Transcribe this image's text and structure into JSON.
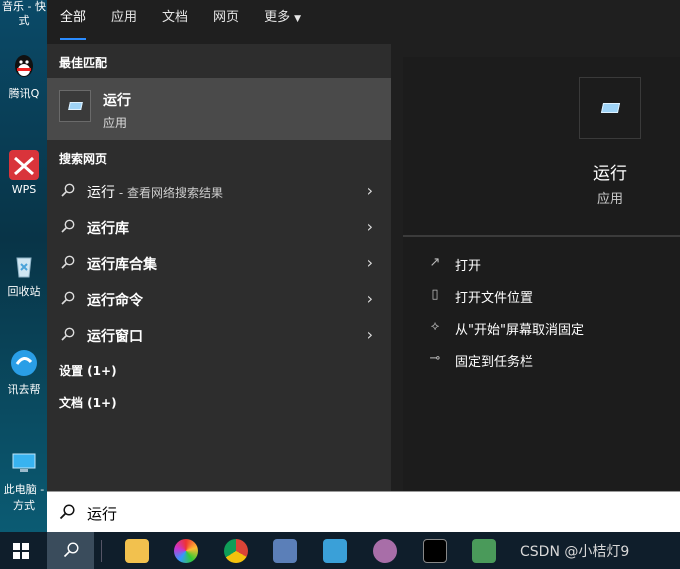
{
  "desktop": {
    "top_label": "音乐 - 快\n式",
    "icons": [
      {
        "label": "腾讯Q"
      },
      {
        "label": "WPS"
      },
      {
        "label": "回收站"
      },
      {
        "label": "讯去帮"
      },
      {
        "label": "此电脑 -\n方式"
      }
    ]
  },
  "tabs": [
    {
      "label": "全部"
    },
    {
      "label": "应用"
    },
    {
      "label": "文档"
    },
    {
      "label": "网页"
    },
    {
      "label": "更多"
    }
  ],
  "left": {
    "best_match_header": "最佳匹配",
    "best_match": {
      "title": "运行",
      "subtitle": "应用"
    },
    "web_header": "搜索网页",
    "web_results": [
      {
        "main": "运行",
        "suffix": " - 查看网络搜索结果"
      },
      {
        "main": "运行库",
        "suffix": ""
      },
      {
        "main": "运行库合集",
        "suffix": ""
      },
      {
        "main": "运行命令",
        "suffix": ""
      },
      {
        "main": "运行窗口",
        "suffix": ""
      }
    ],
    "settings_header": "设置 (1+)",
    "documents_header": "文档 (1+)"
  },
  "right": {
    "title": "运行",
    "subtitle": "应用",
    "actions": [
      {
        "label": "打开",
        "icon": "open-icon"
      },
      {
        "label": "打开文件位置",
        "icon": "file-location-icon"
      },
      {
        "label": "从\"开始\"屏幕取消固定",
        "icon": "unpin-icon"
      },
      {
        "label": "固定到任务栏",
        "icon": "pin-icon"
      }
    ]
  },
  "search": {
    "value": "运行"
  },
  "taskbar": {
    "watermark": "CSDN @小桔灯9"
  },
  "colors": {
    "accent": "#2b8cff",
    "menu_bg": "#1f1f1f",
    "left_bg": "#2d2d2d",
    "selected_bg": "#4a4a4a"
  }
}
